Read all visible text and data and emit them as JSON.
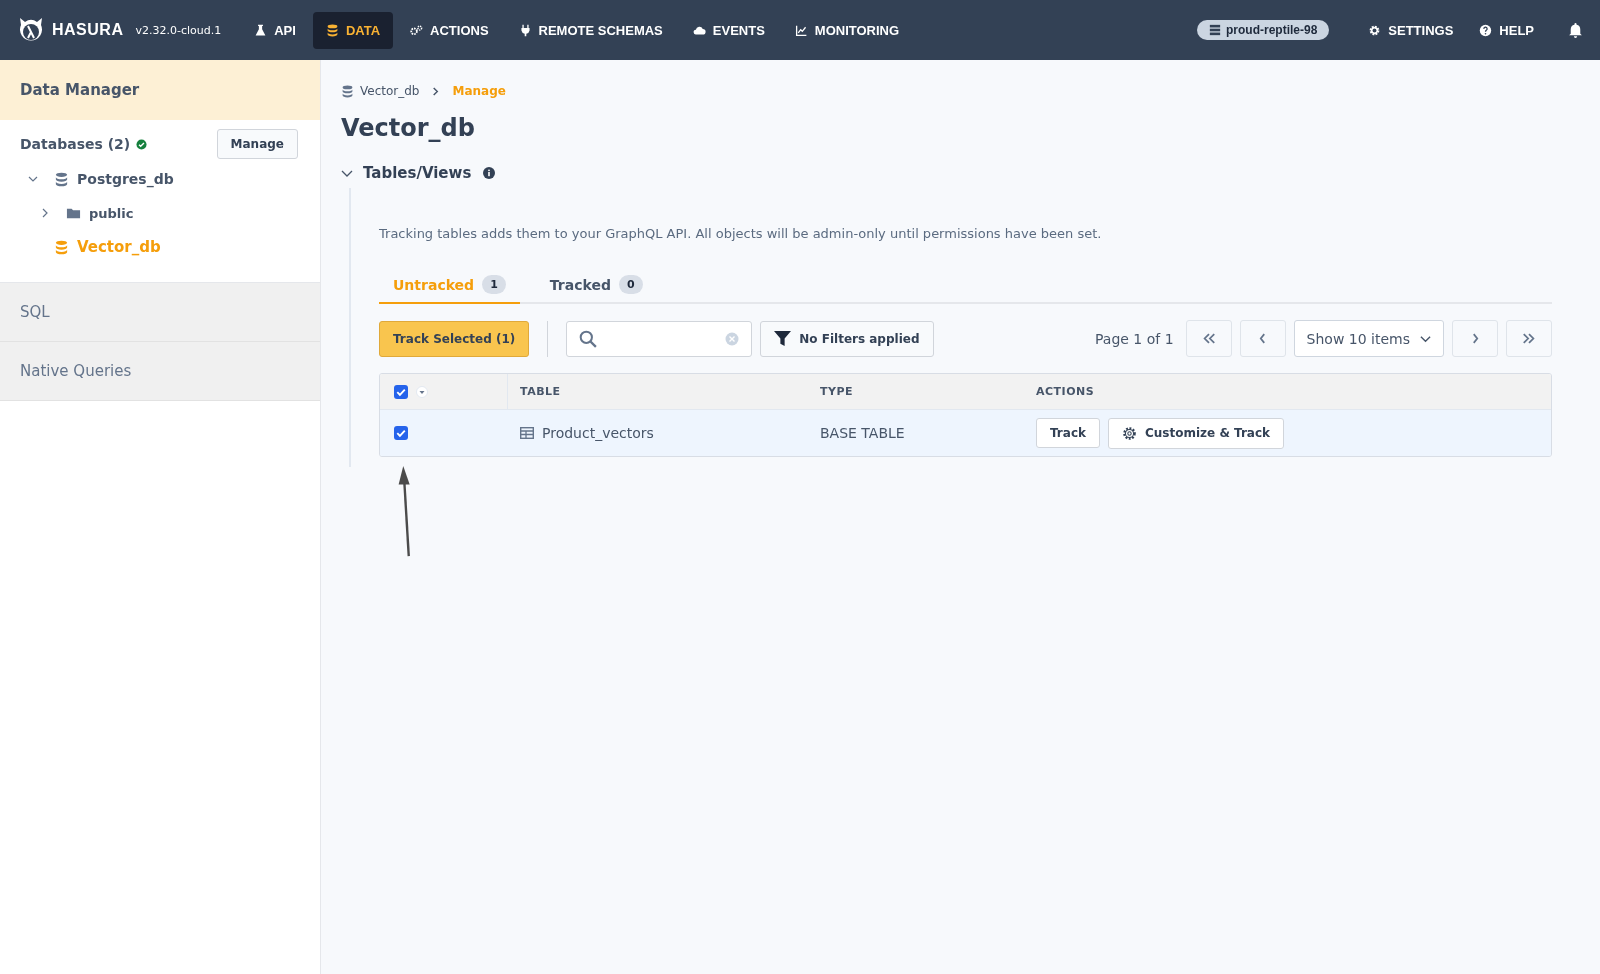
{
  "navbar": {
    "logo": "HASURA",
    "version": "v2.32.0-cloud.1",
    "items": [
      {
        "label": "API",
        "kind": "flask",
        "selected": false
      },
      {
        "label": "DATA",
        "kind": "database",
        "selected": true
      },
      {
        "label": "ACTIONS",
        "kind": "gears",
        "selected": false
      },
      {
        "label": "REMOTE SCHEMAS",
        "kind": "plug",
        "selected": false
      },
      {
        "label": "EVENTS",
        "kind": "cloud",
        "selected": false
      },
      {
        "label": "MONITORING",
        "kind": "chart",
        "selected": false
      }
    ],
    "project": "proud-reptile-98",
    "right_items": [
      {
        "label": "SETTINGS",
        "kind": "gear"
      },
      {
        "label": "HELP",
        "kind": "question"
      }
    ]
  },
  "sidebar": {
    "title": "Data Manager",
    "databases_label": "Databases (2)",
    "status_ok": true,
    "manage_button": "Manage",
    "tree": [
      {
        "label": "Postgres_db",
        "kind": "database",
        "expanded": true,
        "selected": false,
        "children": [
          {
            "label": "public",
            "kind": "schema",
            "expanded": false,
            "selected": false
          }
        ]
      },
      {
        "label": "Vector_db",
        "kind": "database",
        "selected": true
      }
    ],
    "sections": [
      "SQL",
      "Native Queries"
    ]
  },
  "main": {
    "breadcrumb": [
      {
        "label": "Vector_db",
        "selected": false
      },
      {
        "label": "Manage",
        "selected": true
      }
    ],
    "title": "Vector_db",
    "section": {
      "label": "Tables/Views",
      "expanded": true
    },
    "description": "Tracking tables adds them to your GraphQL API. All objects will be admin-only until permissions have been set.",
    "tabs": [
      {
        "label": "Untracked",
        "count": "1",
        "selected": true
      },
      {
        "label": "Tracked",
        "count": "0",
        "selected": false
      }
    ],
    "track_selected_button": "Track Selected (1)",
    "filter_button": "No Filters applied",
    "page_info": "Page 1 of 1",
    "page_size": "Show 10 items",
    "table": {
      "header_checked": true,
      "columns": [
        "TABLE",
        "TYPE",
        "ACTIONS"
      ],
      "rows": [
        {
          "checked": true,
          "table": "Product_vectors",
          "type": "BASE TABLE",
          "actions": [
            {
              "label": "Track",
              "kind": "plain"
            },
            {
              "label": "Customize & Track",
              "kind": "gear"
            }
          ]
        }
      ]
    }
  }
}
